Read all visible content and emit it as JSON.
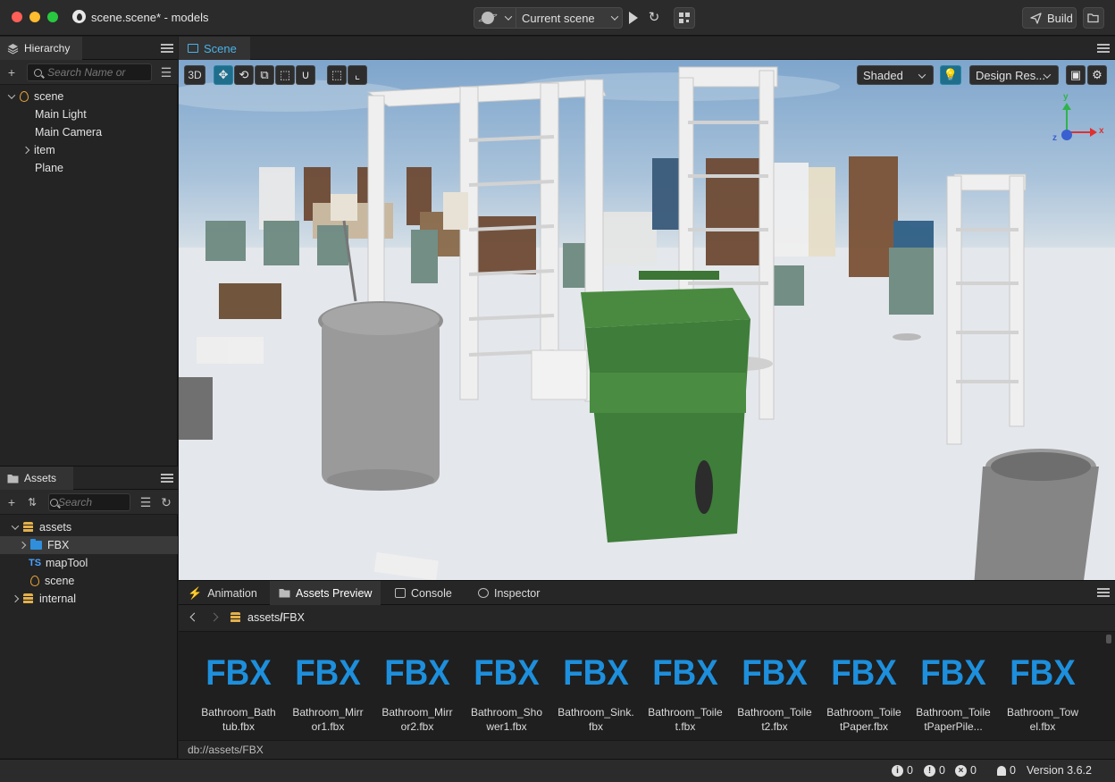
{
  "titlebar": {
    "window_title": "scene.scene* - models",
    "scene_select": "Current scene",
    "build_label": "Build"
  },
  "hierarchy": {
    "tab_label": "Hierarchy",
    "search_placeholder": "Search Name or",
    "items": [
      {
        "label": "scene",
        "icon": "flame-icon",
        "expand": "expanded"
      },
      {
        "label": "Main Light"
      },
      {
        "label": "Main Camera"
      },
      {
        "label": "item",
        "expand": "collapsed"
      },
      {
        "label": "Plane"
      }
    ]
  },
  "assets": {
    "tab_label": "Assets",
    "search_placeholder": "Search",
    "items": [
      {
        "label": "assets",
        "icon": "database-icon",
        "expand": "expanded"
      },
      {
        "label": "FBX",
        "icon": "folder-icon",
        "expand": "collapsed",
        "selected": true
      },
      {
        "label": "mapTool",
        "icon": "typescript-icon",
        "prefix": "TS"
      },
      {
        "label": "scene",
        "icon": "flame-icon"
      },
      {
        "label": "internal",
        "icon": "database-icon",
        "expand": "collapsed"
      }
    ]
  },
  "scene": {
    "tab_label": "Scene",
    "toolbar": {
      "mode_3d": "3D",
      "shading": "Shaded",
      "resolution": "Design Res..."
    },
    "gizmo": {
      "x": "x",
      "y": "y",
      "z": "z"
    }
  },
  "bottom": {
    "tabs": [
      {
        "label": "Animation",
        "icon": "animation-icon"
      },
      {
        "label": "Assets Preview",
        "icon": "folder-icon",
        "active": true
      },
      {
        "label": "Console",
        "icon": "terminal-icon"
      },
      {
        "label": "Inspector",
        "icon": "inspector-icon"
      }
    ],
    "breadcrumb": {
      "root": "assets",
      "sep": "/",
      "current": "FBX"
    },
    "asset_icon_text": "FBX",
    "files": [
      "Bathroom_Bathtub.fbx",
      "Bathroom_Mirror1.fbx",
      "Bathroom_Mirror2.fbx",
      "Bathroom_Shower1.fbx",
      "Bathroom_Sink.fbx",
      "Bathroom_Toilet.fbx",
      "Bathroom_Toilet2.fbx",
      "Bathroom_ToiletPaper.fbx",
      "Bathroom_ToiletPaperPile...",
      "Bathroom_Towel.fbx"
    ],
    "path": "db://assets/FBX"
  },
  "statusbar": {
    "info_count": "0",
    "warn_count": "0",
    "error_count": "0",
    "notify_count": "0",
    "version": "Version 3.6.2"
  },
  "colors": {
    "accent": "#1f6f8c",
    "fbx_blue": "#1d8fdc",
    "trash_green": "#3f7d3a",
    "floor": "#e6e8ec"
  }
}
